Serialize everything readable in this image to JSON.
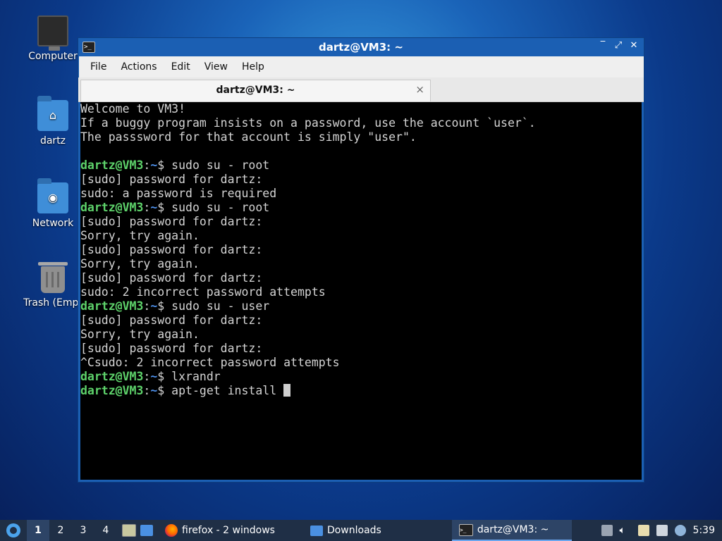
{
  "desktop": {
    "icons": [
      {
        "label": "Computer",
        "icon": "monitor-icon"
      },
      {
        "label": "dartz",
        "icon": "home-folder-icon"
      },
      {
        "label": "Network",
        "icon": "network-folder-icon"
      },
      {
        "label": "Trash (Empt",
        "icon": "trash-icon"
      }
    ]
  },
  "window": {
    "title": "dartz@VM3: ~",
    "controls": {
      "minimize": "‾",
      "maximize": "⤢",
      "close": "✕"
    },
    "menu": [
      "File",
      "Actions",
      "Edit",
      "View",
      "Help"
    ],
    "tab": {
      "title": "dartz@VM3: ~",
      "close": "×"
    }
  },
  "terminal": {
    "colors": {
      "user": "#5ed36b",
      "path": "#4d8fe8",
      "text": "#d4d4d4",
      "background": "#000000"
    },
    "prompt": {
      "user": "dartz@VM3",
      "sep": ":",
      "path": "~",
      "symbol": "$ "
    },
    "lines": [
      {
        "text": "Welcome to VM3!"
      },
      {
        "text": "If a buggy program insists on a password, use the account `user`."
      },
      {
        "text": "The passsword for that account is simply \"user\"."
      },
      {
        "text": ""
      },
      {
        "cmd": "sudo su - root"
      },
      {
        "text": "[sudo] password for dartz:"
      },
      {
        "text": "sudo: a password is required"
      },
      {
        "cmd": "sudo su - root"
      },
      {
        "text": "[sudo] password for dartz:"
      },
      {
        "text": "Sorry, try again."
      },
      {
        "text": "[sudo] password for dartz:"
      },
      {
        "text": "Sorry, try again."
      },
      {
        "text": "[sudo] password for dartz:"
      },
      {
        "text": "sudo: 2 incorrect password attempts"
      },
      {
        "cmd": "sudo su - user"
      },
      {
        "text": "[sudo] password for dartz:"
      },
      {
        "text": "Sorry, try again."
      },
      {
        "text": "[sudo] password for dartz:"
      },
      {
        "text": "^Csudo: 2 incorrect password attempts"
      },
      {
        "cmd": "lxrandr"
      },
      {
        "cmd": "apt-get install ",
        "cursor": true
      }
    ]
  },
  "taskbar": {
    "desktops": [
      "1",
      "2",
      "3",
      "4"
    ],
    "active_desktop": "1",
    "tasks": [
      {
        "label": "firefox - 2 windows",
        "icon": "firefox-icon"
      },
      {
        "label": "Downloads",
        "icon": "folder-icon"
      },
      {
        "label": "dartz@VM3: ~",
        "icon": "terminal-icon",
        "active": true
      }
    ],
    "tray_icons": [
      "eject-icon",
      "volume-icon",
      "clipboard-icon",
      "network-icon",
      "update-icon"
    ],
    "clock": "5:39"
  }
}
